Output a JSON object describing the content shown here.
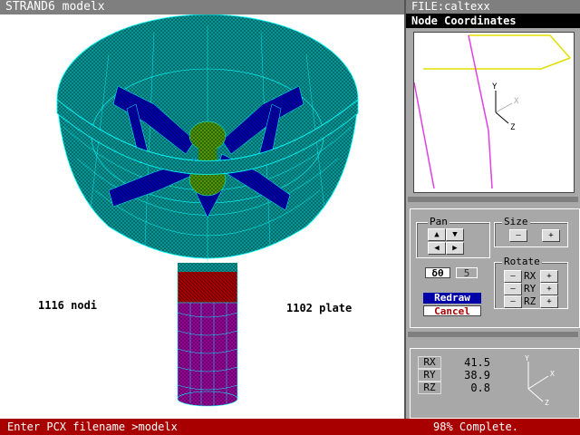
{
  "window": {
    "title": "STRAND6 modelx"
  },
  "side": {
    "file_title": "FILE:caltexx",
    "panel_title": "Node Coordinates",
    "pan_label": "Pan",
    "size_label": "Size",
    "rotate_label": "Rotate",
    "dtheta_label": "δθ",
    "dtheta_value": "5",
    "redraw_label": "Redraw",
    "cancel_label": "Cancel",
    "rotate_axes": [
      "RX",
      "RY",
      "RZ"
    ],
    "readout": [
      {
        "axis": "RX",
        "value": "41.5"
      },
      {
        "axis": "RY",
        "value": "38.9"
      },
      {
        "axis": "RZ",
        "value": "0.8"
      }
    ],
    "mini_axes": {
      "x": "X",
      "y": "Y",
      "z": "Z"
    }
  },
  "viewport": {
    "nodes_label": "1116 nodi",
    "plates_label": "1102 plate"
  },
  "status": {
    "prompt": "Enter PCX filename >modelx",
    "progress_text": "98% Complete."
  },
  "colors": {
    "mesh_cyan": "#00aaaa",
    "bowl_fill": "#00a8a8",
    "arms_blue": "#0000a8",
    "hub_green": "#55a800",
    "neck_red": "#a80000",
    "column_magenta": "#a800a8",
    "status_bar": "#a80000"
  }
}
